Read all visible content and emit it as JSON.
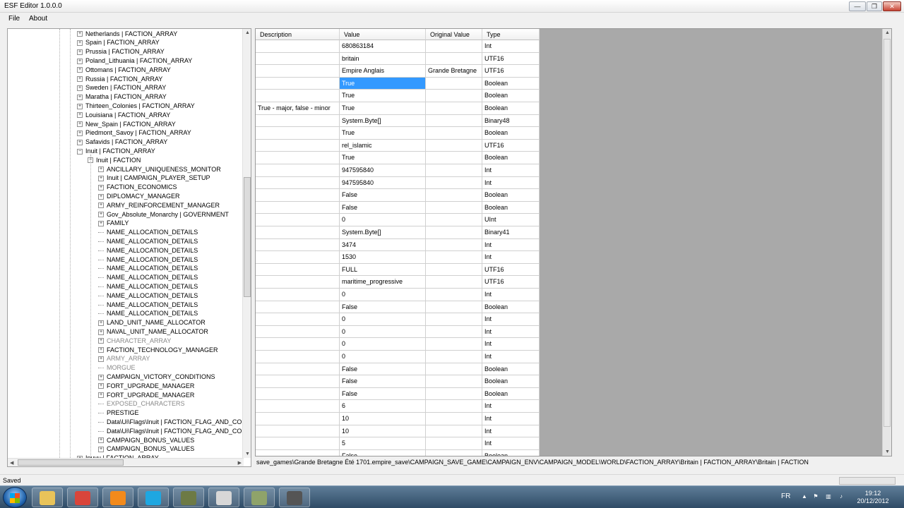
{
  "window": {
    "title": "ESF Editor 1.0.0.0"
  },
  "menu": [
    "File",
    "About"
  ],
  "tree": {
    "nodes": [
      {
        "label": "Netherlands | FACTION_ARRAY",
        "level": 1,
        "exp": "+"
      },
      {
        "label": "Spain | FACTION_ARRAY",
        "level": 1,
        "exp": "+"
      },
      {
        "label": "Prussia | FACTION_ARRAY",
        "level": 1,
        "exp": "+"
      },
      {
        "label": "Poland_Lithuania | FACTION_ARRAY",
        "level": 1,
        "exp": "+"
      },
      {
        "label": "Ottomans | FACTION_ARRAY",
        "level": 1,
        "exp": "+"
      },
      {
        "label": "Russia | FACTION_ARRAY",
        "level": 1,
        "exp": "+"
      },
      {
        "label": "Sweden | FACTION_ARRAY",
        "level": 1,
        "exp": "+"
      },
      {
        "label": "Maratha | FACTION_ARRAY",
        "level": 1,
        "exp": "+"
      },
      {
        "label": "Thirteen_Colonies | FACTION_ARRAY",
        "level": 1,
        "exp": "+"
      },
      {
        "label": "Louisiana | FACTION_ARRAY",
        "level": 1,
        "exp": "+"
      },
      {
        "label": "New_Spain | FACTION_ARRAY",
        "level": 1,
        "exp": "+"
      },
      {
        "label": "Piedmont_Savoy | FACTION_ARRAY",
        "level": 1,
        "exp": "+"
      },
      {
        "label": "Safavids | FACTION_ARRAY",
        "level": 1,
        "exp": "+"
      },
      {
        "label": "Inuit | FACTION_ARRAY",
        "level": 1,
        "exp": "-"
      },
      {
        "label": "Inuit | FACTION",
        "level": 2,
        "exp": "-"
      },
      {
        "label": "ANCILLARY_UNIQUENESS_MONITOR",
        "level": 3,
        "exp": "+"
      },
      {
        "label": "Inuit | CAMPAIGN_PLAYER_SETUP",
        "level": 3,
        "exp": "+"
      },
      {
        "label": "FACTION_ECONOMICS",
        "level": 3,
        "exp": "+"
      },
      {
        "label": "DIPLOMACY_MANAGER",
        "level": 3,
        "exp": "+"
      },
      {
        "label": "ARMY_REINFORCEMENT_MANAGER",
        "level": 3,
        "exp": "+"
      },
      {
        "label": "Gov_Absolute_Monarchy | GOVERNMENT",
        "level": 3,
        "exp": "+"
      },
      {
        "label": "FAMILY",
        "level": 3,
        "exp": "+"
      },
      {
        "label": "NAME_ALLOCATION_DETAILS",
        "level": 3,
        "exp": ""
      },
      {
        "label": "NAME_ALLOCATION_DETAILS",
        "level": 3,
        "exp": ""
      },
      {
        "label": "NAME_ALLOCATION_DETAILS",
        "level": 3,
        "exp": ""
      },
      {
        "label": "NAME_ALLOCATION_DETAILS",
        "level": 3,
        "exp": ""
      },
      {
        "label": "NAME_ALLOCATION_DETAILS",
        "level": 3,
        "exp": ""
      },
      {
        "label": "NAME_ALLOCATION_DETAILS",
        "level": 3,
        "exp": ""
      },
      {
        "label": "NAME_ALLOCATION_DETAILS",
        "level": 3,
        "exp": ""
      },
      {
        "label": "NAME_ALLOCATION_DETAILS",
        "level": 3,
        "exp": ""
      },
      {
        "label": "NAME_ALLOCATION_DETAILS",
        "level": 3,
        "exp": ""
      },
      {
        "label": "NAME_ALLOCATION_DETAILS",
        "level": 3,
        "exp": ""
      },
      {
        "label": "LAND_UNIT_NAME_ALLOCATOR",
        "level": 3,
        "exp": "+"
      },
      {
        "label": "NAVAL_UNIT_NAME_ALLOCATOR",
        "level": 3,
        "exp": "+"
      },
      {
        "label": "CHARACTER_ARRAY",
        "level": 3,
        "exp": "+",
        "grey": true
      },
      {
        "label": "FACTION_TECHNOLOGY_MANAGER",
        "level": 3,
        "exp": "+"
      },
      {
        "label": "ARMY_ARRAY",
        "level": 3,
        "exp": "+",
        "grey": true
      },
      {
        "label": "MORGUE",
        "level": 3,
        "exp": "",
        "grey": true
      },
      {
        "label": "CAMPAIGN_VICTORY_CONDITIONS",
        "level": 3,
        "exp": "+"
      },
      {
        "label": "FORT_UPGRADE_MANAGER",
        "level": 3,
        "exp": "+"
      },
      {
        "label": "FORT_UPGRADE_MANAGER",
        "level": 3,
        "exp": "+"
      },
      {
        "label": "EXPOSED_CHARACTERS",
        "level": 3,
        "exp": "",
        "grey": true
      },
      {
        "label": "PRESTIGE",
        "level": 3,
        "exp": ""
      },
      {
        "label": "Data\\Ui\\Flags\\Inuit | FACTION_FLAG_AND_COLO",
        "level": 3,
        "exp": ""
      },
      {
        "label": "Data\\Ui\\Flags\\Inuit | FACTION_FLAG_AND_COLO",
        "level": 3,
        "exp": ""
      },
      {
        "label": "CAMPAIGN_BONUS_VALUES",
        "level": 3,
        "exp": "+"
      },
      {
        "label": "CAMPAIGN_BONUS_VALUES",
        "level": 3,
        "exp": "+"
      },
      {
        "label": "Inuvu | FACTION_ARRAY",
        "level": 1,
        "exp": "+"
      }
    ]
  },
  "grid": {
    "columns": [
      "Description",
      "Value",
      "Original Value",
      "Type"
    ],
    "rows": [
      [
        "",
        "680863184",
        "",
        "Int"
      ],
      [
        "",
        "britain",
        "",
        "UTF16"
      ],
      [
        "",
        "Empire Anglais",
        "Grande Bretagne",
        "UTF16"
      ],
      [
        "",
        "True",
        "",
        "Boolean"
      ],
      [
        "",
        "True",
        "",
        "Boolean"
      ],
      [
        "True - major, false - minor",
        "True",
        "",
        "Boolean"
      ],
      [
        "",
        "System.Byte[]",
        "",
        "Binary48"
      ],
      [
        "",
        "True",
        "",
        "Boolean"
      ],
      [
        "",
        "rel_islamic",
        "",
        "UTF16"
      ],
      [
        "",
        "True",
        "",
        "Boolean"
      ],
      [
        "",
        "947595840",
        "",
        "Int"
      ],
      [
        "",
        "947595840",
        "",
        "Int"
      ],
      [
        "",
        "False",
        "",
        "Boolean"
      ],
      [
        "",
        "False",
        "",
        "Boolean"
      ],
      [
        "",
        "0",
        "",
        "UInt"
      ],
      [
        "",
        "System.Byte[]",
        "",
        "Binary41"
      ],
      [
        "",
        "3474",
        "",
        "Int"
      ],
      [
        "",
        "1530",
        "",
        "Int"
      ],
      [
        "",
        "FULL",
        "",
        "UTF16"
      ],
      [
        "",
        "maritime_progressive",
        "",
        "UTF16"
      ],
      [
        "",
        "0",
        "",
        "Int"
      ],
      [
        "",
        "False",
        "",
        "Boolean"
      ],
      [
        "",
        "0",
        "",
        "Int"
      ],
      [
        "",
        "0",
        "",
        "Int"
      ],
      [
        "",
        "0",
        "",
        "Int"
      ],
      [
        "",
        "0",
        "",
        "Int"
      ],
      [
        "",
        "False",
        "",
        "Boolean"
      ],
      [
        "",
        "False",
        "",
        "Boolean"
      ],
      [
        "",
        "False",
        "",
        "Boolean"
      ],
      [
        "",
        "6",
        "",
        "Int"
      ],
      [
        "",
        "10",
        "",
        "Int"
      ],
      [
        "",
        "10",
        "",
        "Int"
      ],
      [
        "",
        "5",
        "",
        "Int"
      ],
      [
        "",
        "False",
        "",
        "Boolean"
      ]
    ],
    "selected_row": 3
  },
  "path": "save_games\\Grande Bretagne Été 1701.empire_save\\CAMPAIGN_SAVE_GAME\\CAMPAIGN_ENV\\CAMPAIGN_MODEL\\WORLD\\FACTION_ARRAY\\Britain | FACTION_ARRAY\\Britain | FACTION",
  "status": "Saved",
  "taskbar": {
    "apps": [
      {
        "name": "explorer-icon",
        "color": "#e8c35a"
      },
      {
        "name": "chrome-icon",
        "color": "#d9453b"
      },
      {
        "name": "media-player-icon",
        "color": "#f28a1c"
      },
      {
        "name": "skype-icon",
        "color": "#1ea7e1"
      },
      {
        "name": "game-icon",
        "color": "#6d7a45"
      },
      {
        "name": "esf-editor-icon",
        "color": "#d7d7d7"
      },
      {
        "name": "map-app-icon",
        "color": "#8fa36a"
      },
      {
        "name": "camera-app-icon",
        "color": "#555555"
      }
    ],
    "lang": "FR",
    "time": "19:12",
    "date": "20/12/2012"
  }
}
